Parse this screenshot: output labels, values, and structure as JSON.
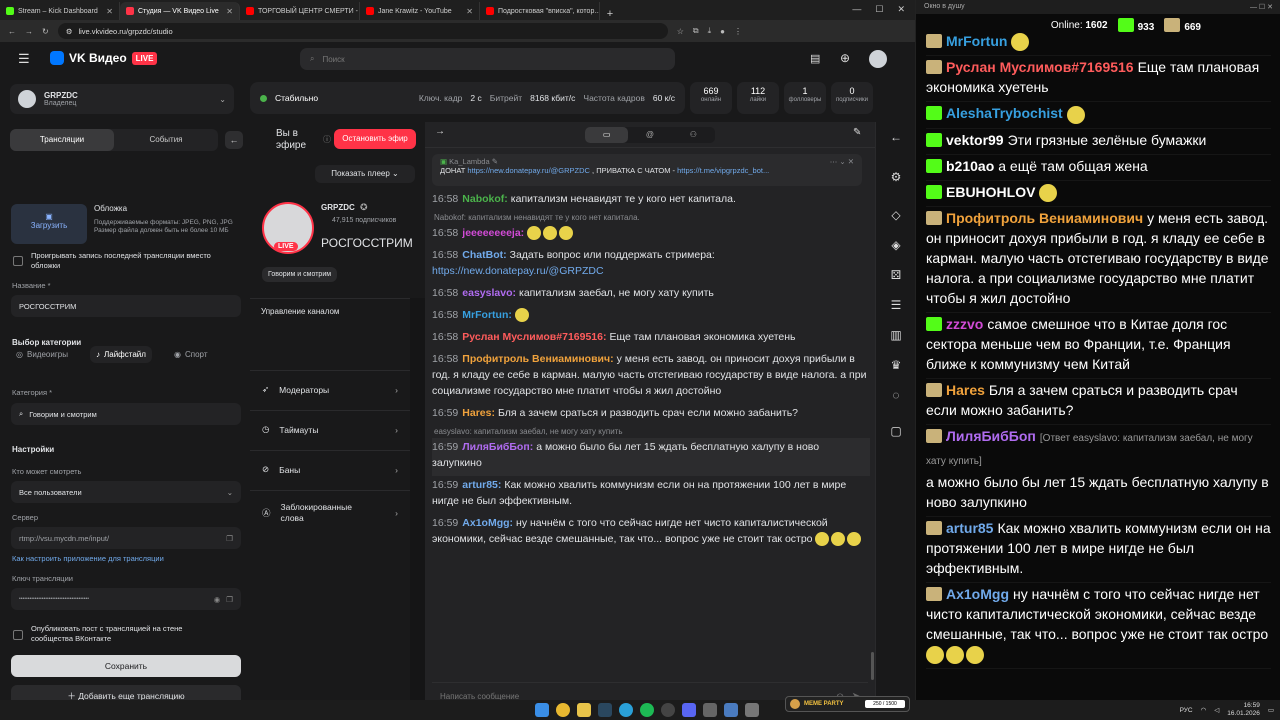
{
  "browser": {
    "tabs": [
      {
        "title": "Stream – Kick Dashboard",
        "color": "#53fc18",
        "active": false
      },
      {
        "title": "Студия — VK Видео Live",
        "color": "#ff3347",
        "active": true
      },
      {
        "title": "ТОРГОВЫЙ ЦЕНТР СМЕРТИ - ...",
        "color": "#ff0000",
        "active": false
      },
      {
        "title": "Jane Krawitz - YouTube",
        "color": "#ff0000",
        "active": false
      },
      {
        "title": "Подростковая \"вписка\", котор...",
        "color": "#ff0000",
        "active": false
      }
    ],
    "url": "live.vkvideo.ru/grpzdc/studio"
  },
  "site": {
    "brand": "VK Видео",
    "brand_live": "LIVE",
    "search_placeholder": "Поиск"
  },
  "left": {
    "owner_name": "GRPZDC",
    "owner_role": "Владелец",
    "tab_streams": "Трансляции",
    "tab_events": "События",
    "cover_title": "Обложка",
    "cover_upload": "Загрузить",
    "cover_hint": "Поддерживаемые форматы: JPEG, PNG, JPG Размер файла должен быть не более 10 МБ",
    "record_label": "Проигрывать запись последней трансляции вместо обложки",
    "name_label": "Название *",
    "name_value": "РОСГОССТРИМ",
    "category_section": "Выбор категории",
    "cat_games": "Видеоигры",
    "cat_life": "Лайфстайл",
    "cat_sport": "Спорт",
    "category_label": "Категория *",
    "category_value": "Говорим и смотрим",
    "settings_title": "Настройки",
    "who_label": "Кто может смотреть",
    "who_value": "Все пользователи",
    "server_label": "Сервер",
    "server_value": "rtmp://vsu.mycdn.me/input/",
    "howto_link": "Как настроить приложение для трансляции",
    "key_label": "Ключ трансляции",
    "key_value": "••••••••••••••••••••••••••••••••••••••••",
    "publish_label": "Опубликовать пост с трансляцией на стене сообщества ВКонтакте",
    "save_btn": "Сохранить",
    "add_btn": "Добавить еще трансляцию"
  },
  "status": {
    "state": "Стабильно",
    "keyframe_label": "Ключ. кадр",
    "keyframe_value": "2 с",
    "bitrate_label": "Битрейт",
    "bitrate_value": "8168 кбит/с",
    "fps_label": "Частота кадров",
    "fps_value": "60 к/с"
  },
  "stats": [
    {
      "value": "669",
      "label": "онлайн"
    },
    {
      "value": "112",
      "label": "лайки"
    },
    {
      "value": "1",
      "label": "фолловеры"
    },
    {
      "value": "0",
      "label": "подписчики"
    }
  ],
  "middle": {
    "on_air": "Вы в эфире",
    "stop_btn": "Остановить эфир",
    "show_player": "Показать плеер",
    "channel_name": "GRPZDC",
    "subscribers": "47,915 подписчиков",
    "stream_title": "РОСГОССТРИМ",
    "live_label": "LIVE",
    "category_chip": "Говорим и смотрим",
    "mgmt_title": "Управление каналом",
    "mgmt_items": [
      "Модераторы",
      "Таймауты",
      "Баны",
      "Заблокированные слова"
    ]
  },
  "chat": {
    "pinned_author": "Ka_Lambda",
    "pinned_text": "ДОНАТ ",
    "pinned_link1": "https://new.donatepay.ru/@GRPZDC",
    "pinned_mid": " , ПРИВАТКА С ЧАТОМ - ",
    "pinned_link2": "https://t.me/vipgrpzdc_bot...",
    "reply1": "Nabokof: капитализм ненавидят те у кого нет капитала.",
    "reply2": "easyslavo: капитализм заебал, не могу хату купить",
    "placeholder": "Написать сообщение",
    "messages": [
      {
        "time": "16:58",
        "user": "Nabokof:",
        "color": "#4bb34b",
        "text": "капитализм ненавидят те у кого нет капитала."
      },
      {
        "time": "16:58",
        "user": "jeeeeeeeeja:",
        "color": "#d14bd6",
        "text": ""
      },
      {
        "time": "16:58",
        "user": "ChatBot:",
        "color": "#71aaeb",
        "text": "Задать вопрос или поддержать стримера:",
        "link": "https://new.donatepay.ru/@GRPZDC"
      },
      {
        "time": "16:58",
        "user": "easyslavo:",
        "color": "#b06cf0",
        "text": "капитализм заебал, не могу хату купить"
      },
      {
        "time": "16:58",
        "user": "MrFortun:",
        "color": "#37a0e0",
        "text": ""
      },
      {
        "time": "16:58",
        "user": "Руслан Муслимов#7169516:",
        "color": "#ff5c5c",
        "text": "Еще там плановая экономика хуетень"
      },
      {
        "time": "16:58",
        "user": "Профитроль Вениаминович:",
        "color": "#f0a23c",
        "text": "у меня есть завод. он приносит дохуя прибыли в год. я кладу ее себе в карман. малую часть отстегиваю государству в виде налога. а при социализме государство мне платит чтобы я жил достойно"
      },
      {
        "time": "16:59",
        "user": "Hares:",
        "color": "#f0a23c",
        "text": "Бля а зачем сраться и разводить срач если можно забанить?"
      },
      {
        "time": "16:59",
        "user": "ЛиляБибБоп:",
        "color": "#b06cf0",
        "text": "а можно было бы лет 15 ждать бесплатную халупу в ново залупкино"
      },
      {
        "time": "16:59",
        "user": "artur85:",
        "color": "#71aaeb",
        "text": "Как можно хвалить коммунизм если он на протяжении 100 лет в мире нигде не был эффективным."
      },
      {
        "time": "16:59",
        "user": "Ax1oMgg:",
        "color": "#71aaeb",
        "text": "ну начнём с того что сейчас нигде нет чисто капиталистической экономики, сейчас везде смешанные, так что... вопрос уже не стоит так остро"
      }
    ]
  },
  "kick": {
    "window_title": "Окно в душу",
    "online_label": "Online:",
    "online_value": "1602",
    "followers": "933",
    "viewers": "669",
    "messages": [
      {
        "badge": "m",
        "user": "MrFortun",
        "color": "#37a0e0",
        "text": ""
      },
      {
        "badge": "m",
        "user": "Руслан Муслимов#7169516",
        "color": "#ff5c5c",
        "text": "Еще там плановая экономика хуетень"
      },
      {
        "badge": "k",
        "user": "AleshaTrybochist",
        "color": "#37a0e0",
        "text": ""
      },
      {
        "badge": "k",
        "user": "vektor99",
        "color": "#ffffff",
        "text": "Эти грязные зелёные бумажки"
      },
      {
        "badge": "k",
        "user": "b210ao",
        "color": "#ffffff",
        "text": "а ещё там общая жена"
      },
      {
        "badge": "k",
        "user": "EBUHOHLOV",
        "color": "#ffffff",
        "text": ""
      },
      {
        "badge": "m",
        "user": "Профитроль Вениаминович",
        "color": "#f0a23c",
        "text": "у меня есть завод. он приносит дохуя прибыли в год. я кладу ее себе в карман. малую часть отстегиваю государству в виде налога. а при социализме государство мне платит чтобы я жил достойно"
      },
      {
        "badge": "k",
        "user": "zzzvo",
        "color": "#d14bd6",
        "text": "самое смешное что в Китае доля гос сектора меньше чем во Франции, т.е. Франция ближе к коммунизму чем Китай"
      },
      {
        "badge": "m",
        "user": "Hares",
        "color": "#f0a23c",
        "text": "Бля а зачем сраться и разводить срач если можно забанить?"
      },
      {
        "badge": "m",
        "user": "ЛиляБибБоп",
        "color": "#b06cf0",
        "reply": "[Ответ easyslavo: капитализм заебал, не могу хату купить]",
        "text": "а можно было бы лет 15 ждать бесплатную халупу в ново залупкино"
      },
      {
        "badge": "m",
        "user": "artur85",
        "color": "#71aaeb",
        "text": "Как можно хвалить коммунизм если он на протяжении 100 лет в мире нигде не был эффективным."
      },
      {
        "badge": "m",
        "user": "Ax1oMgg",
        "color": "#71aaeb",
        "text": "ну начнём с того что сейчас нигде нет чисто капиталистической экономики, сейчас везде смешанные, так что... вопрос уже не стоит так остро"
      }
    ]
  },
  "taskbar": {
    "meme_label": "MEME PARTY",
    "meme_progress": "250 / 1500",
    "lang": "РУС",
    "time": "16:59",
    "date": "16.01.2026"
  }
}
